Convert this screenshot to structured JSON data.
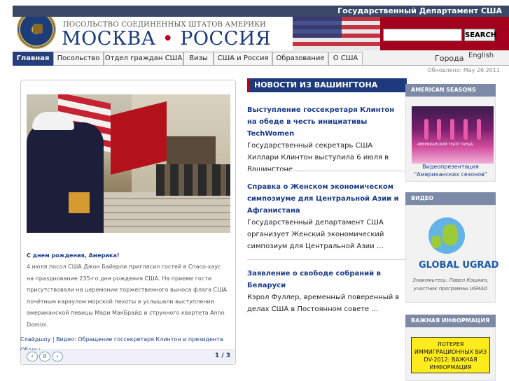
{
  "topbar": {
    "dept": "Государственный Департамент США"
  },
  "header": {
    "embassy": "ПОСОЛЬСТВО СОЕДИНЕННЫХ ШТАТОВ АМЕРИКИ",
    "city_left": "МОСКВА",
    "city_sep": "•",
    "city_right": "РОССИЯ",
    "search_value": "",
    "search_button": "SEARCH"
  },
  "nav": {
    "items": [
      "Главная",
      "Посольство",
      "Отдел граждан США",
      "Визы",
      "США и Россия",
      "Образование",
      "О США"
    ],
    "cities": "Города",
    "english": "English"
  },
  "updated": "Обновлено: May 26 2011",
  "slideshow": {
    "caption_title": "С днем рождения, Америка!",
    "caption_text": "4 июля посол США Джон Байерли пригласил гостей в Спасо-хаус на празднование 235-го дня рождения США. На приеме гости присутствовали на церемонии торжественного выноса флага США почётным караулом морской пехоты и услышали выступления американской певицы Мари МакБрайд и струнного квартета Anno Domini.",
    "links": "Слайдшоу | Видео: Обращение госсекретаря Клинтон и президента Обамы",
    "prev": "‹",
    "pause": "II",
    "next": "›",
    "count": "1 / 3"
  },
  "news": {
    "heading": "НОВОСТИ ИЗ ВАШИНГТОНА",
    "items": [
      {
        "title": "Выступление госсекретаря Клинтон на обеде в честь инициативы TechWomen",
        "desc": "Государственный секретарь США Хиллари Клинтон выступила 6 июля в Вашингтоне …"
      },
      {
        "title": "Справка о Женском экономическом симпозиуме для Центральной Азии и Афганистана",
        "desc": "Государственный департамент США организует Женский экономический симпозиум для Центральной Азии …"
      },
      {
        "title": "Заявление о свободе собраний в Беларуси",
        "desc": "Кэрол Фуллер, временный поверенный в делах США в Постоянном совете …"
      }
    ]
  },
  "sidebar": {
    "seasons_head": "AMERICAN SEASONS",
    "seasons_img_text": "АМЕРИКАНСКИЙ ТЕАТР ТАНЦА",
    "seasons_cap": "Видеопрезентация \"Американских сезонов\"",
    "video_head": "ВИДЕО",
    "ugrad_logo": "GLOBAL UGRAD",
    "ugrad_cap": "Знакомьтесь: Павел Кошкин, участник программы UGRAD",
    "important_head": "ВАЖНАЯ ИНФОРМАЦИЯ",
    "lottery": "ЛОТЕРЕЯ ИММИГРАЦИОННЫХ ВИЗ DV-2012: ВАЖНАЯ ИНФОРМАЦИЯ"
  },
  "colors": {
    "navy": "#1c3a7c",
    "red": "#a3001d",
    "link": "#1a3a8a",
    "yellow": "#ffec1a"
  }
}
